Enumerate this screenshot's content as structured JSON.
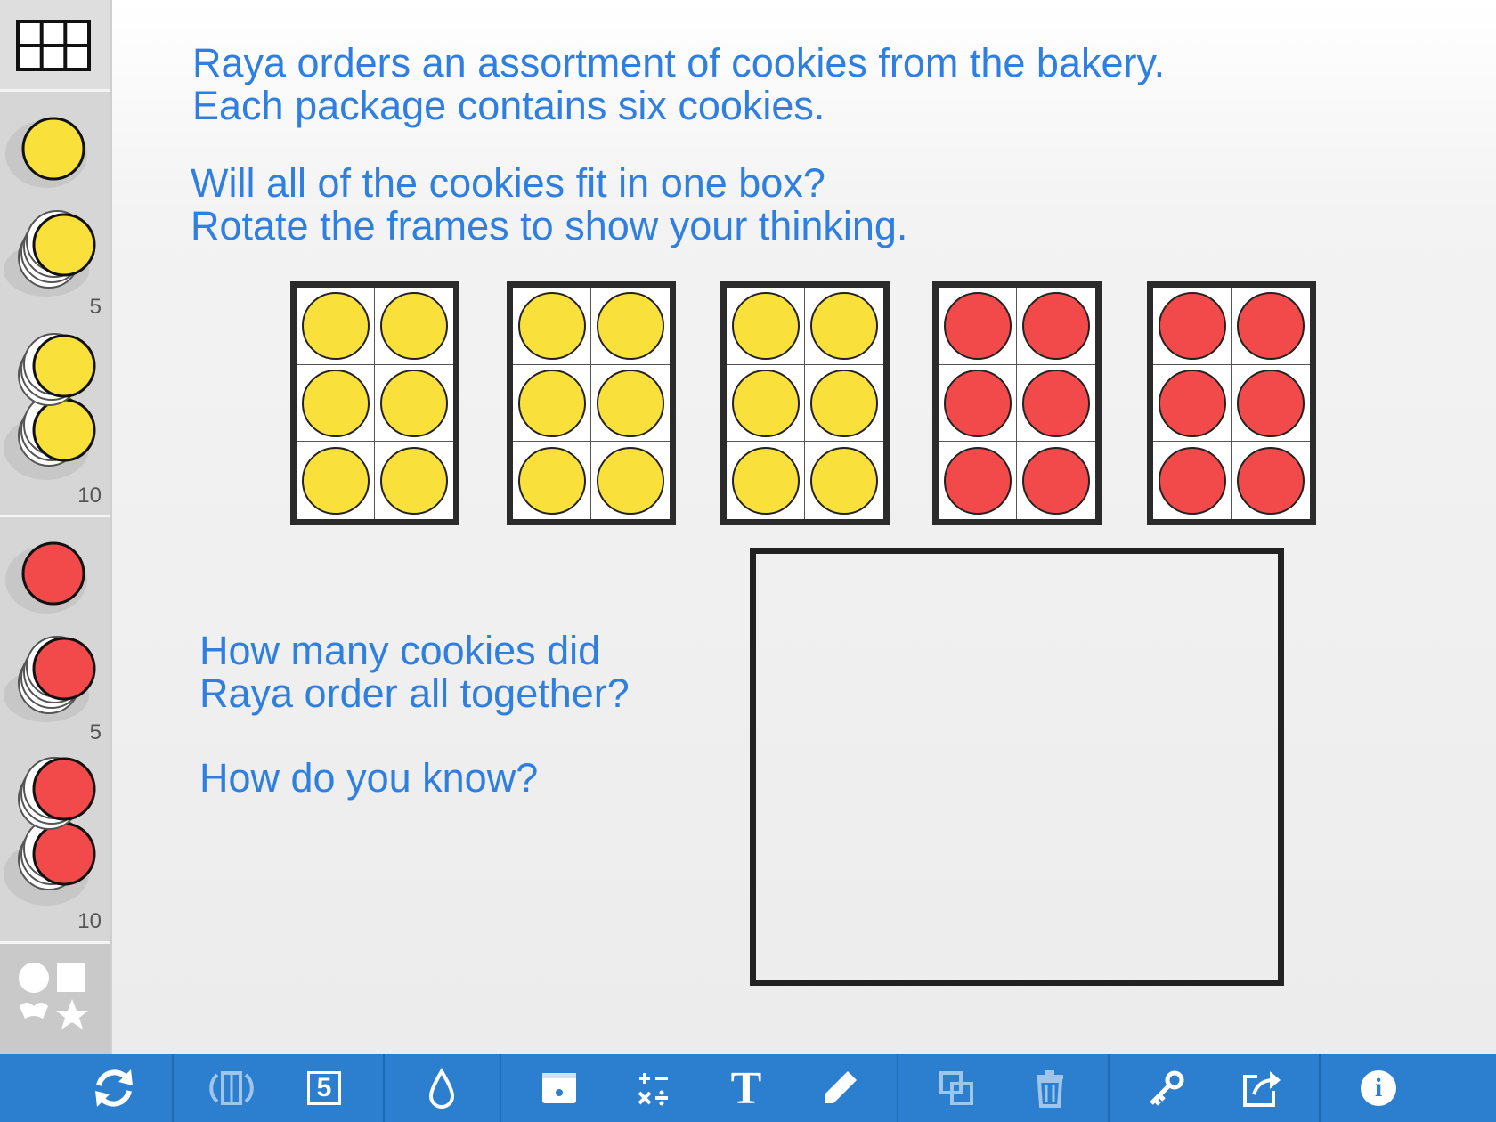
{
  "sidebar": {
    "yellow_stack_small": "5",
    "yellow_stack_large": "10",
    "red_stack_small": "5",
    "red_stack_large": "10"
  },
  "prompt": {
    "line1": "Raya orders an assortment of cookies from the bakery.",
    "line2": "Each package contains six cookies.",
    "line3": "Will all of the cookies fit in one box?",
    "line4": "Rotate the frames to show your thinking.",
    "question1a": "How many cookies did",
    "question1b": "Raya order all together?",
    "question2": "How do you know?"
  },
  "frames": [
    {
      "color": "yellow",
      "cookies": 6
    },
    {
      "color": "yellow",
      "cookies": 6
    },
    {
      "color": "yellow",
      "cookies": 6
    },
    {
      "color": "red",
      "cookies": 6
    },
    {
      "color": "red",
      "cookies": 6
    }
  ],
  "colors": {
    "yellow": "#f9e03b",
    "red": "#f24a4a",
    "toolbar": "#2c7fce",
    "text": "#2f7fe0"
  },
  "toolbar": {
    "buttons": [
      "refresh-icon",
      "flip-icon",
      "five-frame-icon",
      "fill-icon",
      "keyboard-icon",
      "math-ops-icon",
      "text-icon",
      "pencil-icon",
      "duplicate-icon",
      "trash-icon",
      "key-icon",
      "share-icon",
      "info-icon"
    ],
    "five_label": "5",
    "text_label": "T",
    "info_label": "i"
  }
}
